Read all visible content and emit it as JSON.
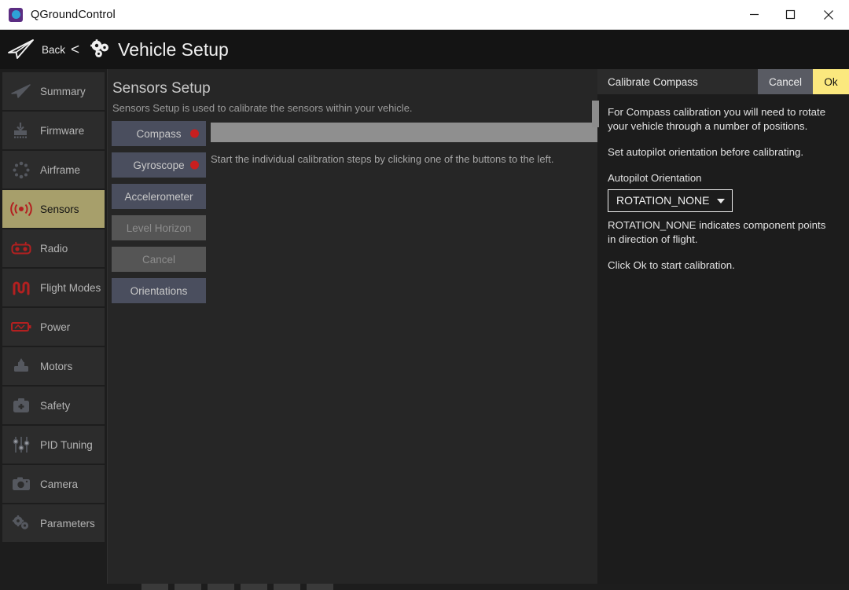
{
  "window": {
    "app_title": "QGroundControl",
    "app_icon": "qgroundcontrol-logo-icon",
    "controls": {
      "minimize": "minimize-icon",
      "maximize": "maximize-icon",
      "close": "close-icon"
    }
  },
  "header": {
    "plane_icon": "paper-plane-icon",
    "back_label": "Back",
    "back_chevron": "<",
    "gear_icon": "gears-icon",
    "page_title": "Vehicle Setup"
  },
  "sidebar": {
    "items": [
      {
        "label": "Summary",
        "icon": "paper-plane-icon",
        "active": false
      },
      {
        "label": "Firmware",
        "icon": "download-chip-icon",
        "active": false
      },
      {
        "label": "Airframe",
        "icon": "quadcopter-icon",
        "active": false
      },
      {
        "label": "Sensors",
        "icon": "sensors-waves-icon",
        "active": true
      },
      {
        "label": "Radio",
        "icon": "rc-transmitter-icon",
        "active": false
      },
      {
        "label": "Flight Modes",
        "icon": "flight-modes-icon",
        "active": false
      },
      {
        "label": "Power",
        "icon": "battery-icon",
        "active": false
      },
      {
        "label": "Motors",
        "icon": "motor-icon",
        "active": false
      },
      {
        "label": "Safety",
        "icon": "first-aid-kit-icon",
        "active": false
      },
      {
        "label": "PID Tuning",
        "icon": "sliders-icon",
        "active": false
      },
      {
        "label": "Camera",
        "icon": "camera-icon",
        "active": false
      },
      {
        "label": "Parameters",
        "icon": "gears-icon",
        "active": false
      }
    ]
  },
  "main": {
    "title": "Sensors Setup",
    "subtitle": "Sensors Setup is used to calibrate the sensors within your vehicle.",
    "buttons": [
      {
        "label": "Compass",
        "enabled": true,
        "indicator": "red"
      },
      {
        "label": "Gyroscope",
        "enabled": true,
        "indicator": "red"
      },
      {
        "label": "Accelerometer",
        "enabled": true,
        "indicator": "none"
      },
      {
        "label": "Level Horizon",
        "enabled": false,
        "indicator": "none"
      },
      {
        "label": "Cancel",
        "enabled": false,
        "indicator": "none"
      },
      {
        "label": "Orientations",
        "enabled": true,
        "indicator": "none"
      }
    ],
    "progress_percent": 100,
    "status_text": "Start the individual calibration steps by clicking one of the buttons to the left."
  },
  "calibration_panel": {
    "title": "Calibrate Compass",
    "cancel_label": "Cancel",
    "ok_label": "Ok",
    "paragraph_1": "For Compass calibration you will need to rotate your vehicle through a number of positions.",
    "paragraph_2": "Set autopilot orientation before calibrating.",
    "orientation_label": "Autopilot Orientation",
    "orientation_value": "ROTATION_NONE",
    "paragraph_3": "ROTATION_NONE indicates component points in direction of flight.",
    "paragraph_4": "Click Ok to start calibration."
  },
  "colors": {
    "accent_highlight": "#a79f6b",
    "ok_button": "#fbe87e",
    "indicator_red": "#c81f1f",
    "button_enabled": "#4a4e5e",
    "button_disabled": "#555555",
    "icon_red": "#b32020",
    "background": "#262626"
  }
}
